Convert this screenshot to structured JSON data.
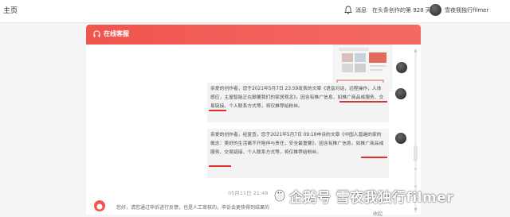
{
  "topbar": {
    "brand": "主页",
    "messages_label": "消息",
    "days_text": "在头条创作的第 928 天",
    "username": "雪夜我独行filmer"
  },
  "chat": {
    "header_title": "在线客服",
    "messages": [
      {
        "text": "亲爱的创作者，您于2021年5月7日 23:59发表的文章《语音对话，远程操作，人体感应，主屋智能正在颠覆我们的家居观念》，因含有推广信息，如推广商品或服务、交易链接、个人联系方式等，将仅推荐给粉丝。"
      },
      {
        "text": "亲爱的创作者，经复查，您于2021年5月7日 09:18申诉的文章《中国人普遍的家的概念：美好的生活离不开陪伴与责任，安全最重要》，因含有推广信息，如推广商品或服务、交易链接、个人联系方式等，将仅推荐给粉丝。"
      }
    ],
    "timestamp": "05月11日 21:49",
    "cs_reply": "您好，请您通过申诉进行反馈，也是人工审核的，申诉会更快得到结果的",
    "fold_label": "收起"
  },
  "watermark": "企鹅号 雪夜我独行filmer",
  "colors": {
    "brand_red": "#f0554e",
    "underline_red": "#e0302a"
  }
}
